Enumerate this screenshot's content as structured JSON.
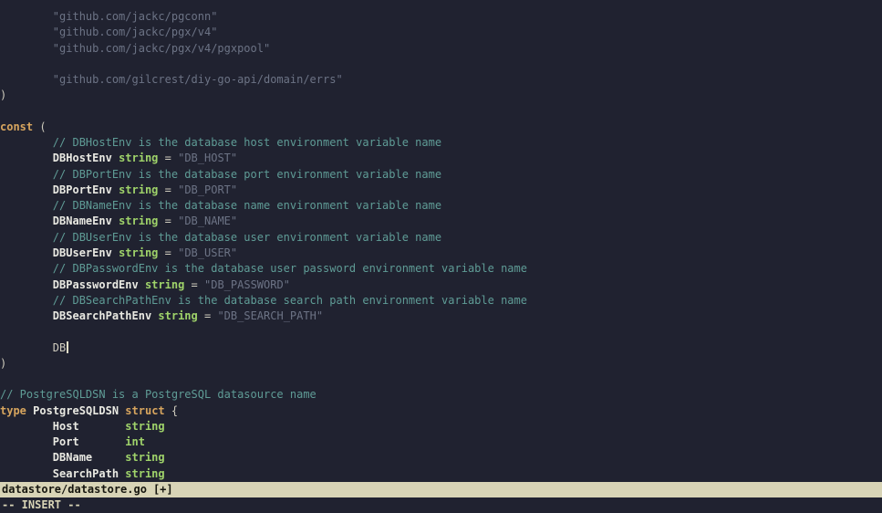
{
  "colors": {
    "background": "#202230",
    "foreground": "#cfccbe",
    "comment": "#5f9c96",
    "keyword": "#d7a55e",
    "identifier": "#e9e9e2",
    "type": "#9fd36a",
    "string": "#6c7385",
    "statusbar_bg": "#d8d4b6",
    "statusbar_fg": "#16160f",
    "mode_fg": "#d8d4b6",
    "cursor": "#e2dfc8"
  },
  "status": {
    "file": "datastore/datastore.go",
    "modified_flag": "[+]",
    "mode": "-- INSERT --"
  },
  "editor": {
    "lines": [
      {
        "spans": [
          {
            "t": "        \"github.com/jackc/pgconn\"",
            "s": "str"
          }
        ]
      },
      {
        "spans": [
          {
            "t": "        \"github.com/jackc/pgx/v4\"",
            "s": "str"
          }
        ]
      },
      {
        "spans": [
          {
            "t": "        \"github.com/jackc/pgx/v4/pgxpool\"",
            "s": "str"
          }
        ]
      },
      {
        "spans": []
      },
      {
        "spans": [
          {
            "t": "        \"github.com/gilcrest/diy-go-api/domain/errs\"",
            "s": "str"
          }
        ]
      },
      {
        "spans": [
          {
            "t": ")",
            "s": "plain"
          }
        ]
      },
      {
        "spans": []
      },
      {
        "spans": [
          {
            "t": "const",
            "s": "kw"
          },
          {
            "t": " (",
            "s": "plain"
          }
        ]
      },
      {
        "spans": [
          {
            "t": "        // DBHostEnv is the database host environment variable name",
            "s": "comment"
          }
        ]
      },
      {
        "spans": [
          {
            "t": "        ",
            "s": "plain"
          },
          {
            "t": "DBHostEnv",
            "s": "ident"
          },
          {
            "t": " ",
            "s": "plain"
          },
          {
            "t": "string",
            "s": "type"
          },
          {
            "t": " = ",
            "s": "plain"
          },
          {
            "t": "\"DB_HOST\"",
            "s": "str"
          }
        ]
      },
      {
        "spans": [
          {
            "t": "        // DBPortEnv is the database port environment variable name",
            "s": "comment"
          }
        ]
      },
      {
        "spans": [
          {
            "t": "        ",
            "s": "plain"
          },
          {
            "t": "DBPortEnv",
            "s": "ident"
          },
          {
            "t": " ",
            "s": "plain"
          },
          {
            "t": "string",
            "s": "type"
          },
          {
            "t": " = ",
            "s": "plain"
          },
          {
            "t": "\"DB_PORT\"",
            "s": "str"
          }
        ]
      },
      {
        "spans": [
          {
            "t": "        // DBNameEnv is the database name environment variable name",
            "s": "comment"
          }
        ]
      },
      {
        "spans": [
          {
            "t": "        ",
            "s": "plain"
          },
          {
            "t": "DBNameEnv",
            "s": "ident"
          },
          {
            "t": " ",
            "s": "plain"
          },
          {
            "t": "string",
            "s": "type"
          },
          {
            "t": " = ",
            "s": "plain"
          },
          {
            "t": "\"DB_NAME\"",
            "s": "str"
          }
        ]
      },
      {
        "spans": [
          {
            "t": "        // DBUserEnv is the database user environment variable name",
            "s": "comment"
          }
        ]
      },
      {
        "spans": [
          {
            "t": "        ",
            "s": "plain"
          },
          {
            "t": "DBUserEnv",
            "s": "ident"
          },
          {
            "t": " ",
            "s": "plain"
          },
          {
            "t": "string",
            "s": "type"
          },
          {
            "t": " = ",
            "s": "plain"
          },
          {
            "t": "\"DB_USER\"",
            "s": "str"
          }
        ]
      },
      {
        "spans": [
          {
            "t": "        // DBPasswordEnv is the database user password environment variable name",
            "s": "comment"
          }
        ]
      },
      {
        "spans": [
          {
            "t": "        ",
            "s": "plain"
          },
          {
            "t": "DBPasswordEnv",
            "s": "ident"
          },
          {
            "t": " ",
            "s": "plain"
          },
          {
            "t": "string",
            "s": "type"
          },
          {
            "t": " = ",
            "s": "plain"
          },
          {
            "t": "\"DB_PASSWORD\"",
            "s": "str"
          }
        ]
      },
      {
        "spans": [
          {
            "t": "        // DBSearchPathEnv is the database search path environment variable name",
            "s": "comment"
          }
        ]
      },
      {
        "spans": [
          {
            "t": "        ",
            "s": "plain"
          },
          {
            "t": "DBSearchPathEnv",
            "s": "ident"
          },
          {
            "t": " ",
            "s": "plain"
          },
          {
            "t": "string",
            "s": "type"
          },
          {
            "t": " = ",
            "s": "plain"
          },
          {
            "t": "\"DB_SEARCH_PATH\"",
            "s": "str"
          }
        ]
      },
      {
        "spans": []
      },
      {
        "spans": [
          {
            "t": "        DB",
            "s": "plain"
          },
          {
            "s": "cursor"
          }
        ]
      },
      {
        "spans": [
          {
            "t": ")",
            "s": "plain"
          }
        ]
      },
      {
        "spans": []
      },
      {
        "spans": [
          {
            "t": "// PostgreSQLDSN is a PostgreSQL datasource name",
            "s": "comment"
          }
        ]
      },
      {
        "spans": [
          {
            "t": "type",
            "s": "kw"
          },
          {
            "t": " ",
            "s": "plain"
          },
          {
            "t": "PostgreSQLDSN",
            "s": "ident"
          },
          {
            "t": " ",
            "s": "plain"
          },
          {
            "t": "struct",
            "s": "kw"
          },
          {
            "t": " {",
            "s": "plain"
          }
        ]
      },
      {
        "spans": [
          {
            "t": "        ",
            "s": "plain"
          },
          {
            "t": "Host",
            "s": "ident"
          },
          {
            "t": "       ",
            "s": "plain"
          },
          {
            "t": "string",
            "s": "type"
          }
        ]
      },
      {
        "spans": [
          {
            "t": "        ",
            "s": "plain"
          },
          {
            "t": "Port",
            "s": "ident"
          },
          {
            "t": "       ",
            "s": "plain"
          },
          {
            "t": "int",
            "s": "type"
          }
        ]
      },
      {
        "spans": [
          {
            "t": "        ",
            "s": "plain"
          },
          {
            "t": "DBName",
            "s": "ident"
          },
          {
            "t": "     ",
            "s": "plain"
          },
          {
            "t": "string",
            "s": "type"
          }
        ]
      },
      {
        "spans": [
          {
            "t": "        ",
            "s": "plain"
          },
          {
            "t": "SearchPath",
            "s": "ident"
          },
          {
            "t": " ",
            "s": "plain"
          },
          {
            "t": "string",
            "s": "type"
          }
        ]
      }
    ]
  }
}
